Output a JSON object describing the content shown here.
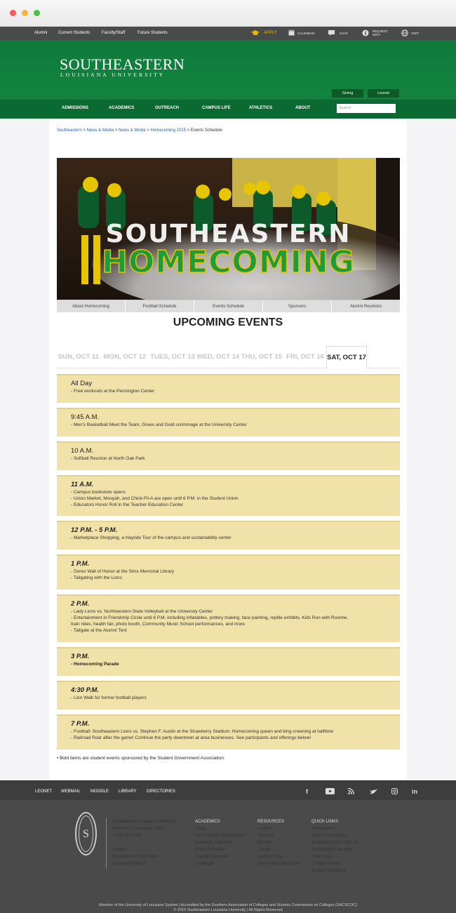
{
  "utility": {
    "links": [
      "Alumni",
      "Current Students",
      "Faculty/Staff",
      "Future Students"
    ],
    "actions": [
      {
        "icon": "graduation-cap-icon",
        "label": "APPLY",
        "color": "#e8b800"
      },
      {
        "icon": "calendar-icon",
        "label": "CALENDAR"
      },
      {
        "icon": "chat-icon",
        "label": "CHAT"
      },
      {
        "icon": "info-icon",
        "label": "REQUEST INFO"
      },
      {
        "icon": "globe-icon",
        "label": "VISIT"
      }
    ]
  },
  "header": {
    "logo_main": "SOUTHEASTERN",
    "logo_sub": "LOUISIANA UNIVERSITY",
    "pills": [
      "Giving",
      "Leonet"
    ],
    "search_placeholder": "Search"
  },
  "nav": [
    "ADMISSIONS",
    "ACADEMICS",
    "OUTREACH",
    "CAMPUS LIFE",
    "ATHLETICS",
    "ABOUT"
  ],
  "breadcrumb": {
    "links": [
      "Southeastern",
      "News & Media",
      "News & Media",
      "Homecoming 2015"
    ],
    "current": "Events Schedule"
  },
  "hero": {
    "line1": "SOUTHEASTERN",
    "line2": "HOMECOMING"
  },
  "subnav": [
    "About Homecoming",
    "Football Schedule",
    "Events Schedule",
    "Sponsors",
    "Alumni Reunions"
  ],
  "events_title": "UPCOMING EVENTS",
  "tabs": [
    "SUN, OCT 11",
    "MON, OCT 12",
    "TUES, OCT 13",
    "WED, OCT 14",
    "THU, OCT 15",
    "FRI, OCT 16",
    "SAT, OCT 17"
  ],
  "active_tab": 6,
  "events": [
    {
      "time": "All Day",
      "lines": [
        "- Free workouts at the Pennington Center"
      ]
    },
    {
      "time": "9:45 A.M.",
      "lines": [
        "- Men's Basketball Meet the Team, Green and Gold scrimmage at the University Center"
      ]
    },
    {
      "time": "10 A.M.",
      "lines": [
        "- Softball Reunion at North Oak Park"
      ]
    },
    {
      "time": "11 A.M.",
      "lines": [
        "- Campus bookstore opens",
        "- Union Market, Mooyah, and Chick-Fil-A are open until 6 P.M. in the Student Union",
        "- Educators Honor Roll in the Teacher Education Center"
      ]
    },
    {
      "time": "12 P.M. - 5 P.M.",
      "lines": [
        "- Marketplace Shopping, a Hayride Tour of the campus and sustainability center"
      ]
    },
    {
      "time": "1 P.M.",
      "lines": [
        "- Donor Wall of Honor at the Sims Memorial Library",
        "- Tailgating with the Lions"
      ]
    },
    {
      "time": "2 P.M.",
      "lines": [
        "- Lady Lions vs. Northwestern State Volleyball at the University Center",
        "- Entertainment in Friendship Circle until 6 P.M. including inflatables, pottery making, face painting, reptile exhibits, Kids Run with Roomie,",
        "train rides, health fair, photo booth, Community Music School performances, and more",
        "- Tailgate at the Alumni Tent"
      ]
    },
    {
      "time": "3 P.M.",
      "lines": [
        "- Homecoming Parade"
      ],
      "bold_lines": [
        0
      ]
    },
    {
      "time": "4:30 P.M.",
      "lines": [
        "- Lion Walk for former football players"
      ]
    },
    {
      "time": "7 P.M.",
      "lines": [
        "- Football: Southeastern Lions vs. Stephen F. Austin at the Strawberry Stadium; Homecoming queen and king crowning at halftime",
        "- Railroad Roar after the game! Continue the party downtown at area businesses. See participants and offerings below!"
      ]
    }
  ],
  "note": "• Bold items are student events sponsored by the Student Government Association.",
  "footer_bar": {
    "links": [
      "LEONET",
      "WEBMAIL",
      "MOODLE",
      "LIBRARY",
      "DIRECTORIES"
    ],
    "social": [
      "facebook-icon",
      "youtube-icon",
      "rss-icon",
      "twitter-icon",
      "instagram-icon",
      "linkedin-icon"
    ]
  },
  "footer": {
    "seal_letter": "S",
    "address": [
      "Southeastern Louisiana University",
      "Hammond, Louisiana 70402",
      "1.800.222.7358"
    ],
    "contact_links": [
      "Contact",
      "Questions or Comments",
      "University Policies"
    ],
    "columns": [
      {
        "heading": "ACADEMICS",
        "links": [
          "Apply",
          "Cost, Aid and Scholarships",
          "Academic Calendar",
          "Exam Schedule",
          "Degree Programs",
          "Catalogue"
        ]
      },
      {
        "heading": "RESOURCES",
        "links": [
          "LeoNet",
          "Webmail",
          "Moodle",
          "Library",
          "Campus Map",
          "Search and Directories"
        ]
      },
      {
        "heading": "QUICK LINKS",
        "links": [
          "Employment",
          "Alumni Association",
          "Emergency Alert Sign Up",
          "Southeastern Identity",
          "Help Desk",
          "College Portrait",
          "Student Handbook"
        ]
      }
    ],
    "copyright_1": "Member of the University of Louisiana System  |  Accredited by the Southern Association of Colleges and Schools Commission on Colleges (SACSCOC)",
    "copyright_2": "© 2015 Southeastern Louisiana University  |  All Rights Reserved"
  }
}
